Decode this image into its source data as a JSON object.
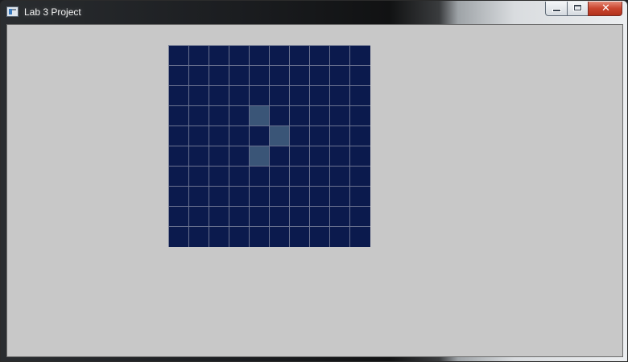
{
  "window": {
    "title": "Lab 3 Project",
    "close_glyph": "✕",
    "icons": {
      "app": "app-window-icon",
      "minimize": "minimize-icon",
      "maximize": "maximize-icon",
      "close": "close-icon"
    }
  },
  "grid": {
    "rows": 10,
    "cols": 10,
    "cell_color": "#0b1a4d",
    "line_color": "#6a7290",
    "highlight_color": "#3a5577",
    "highlighted_cells": [
      [
        3,
        4
      ],
      [
        4,
        5
      ],
      [
        5,
        4
      ]
    ]
  },
  "colors": {
    "client_background": "#c8c8c8"
  }
}
